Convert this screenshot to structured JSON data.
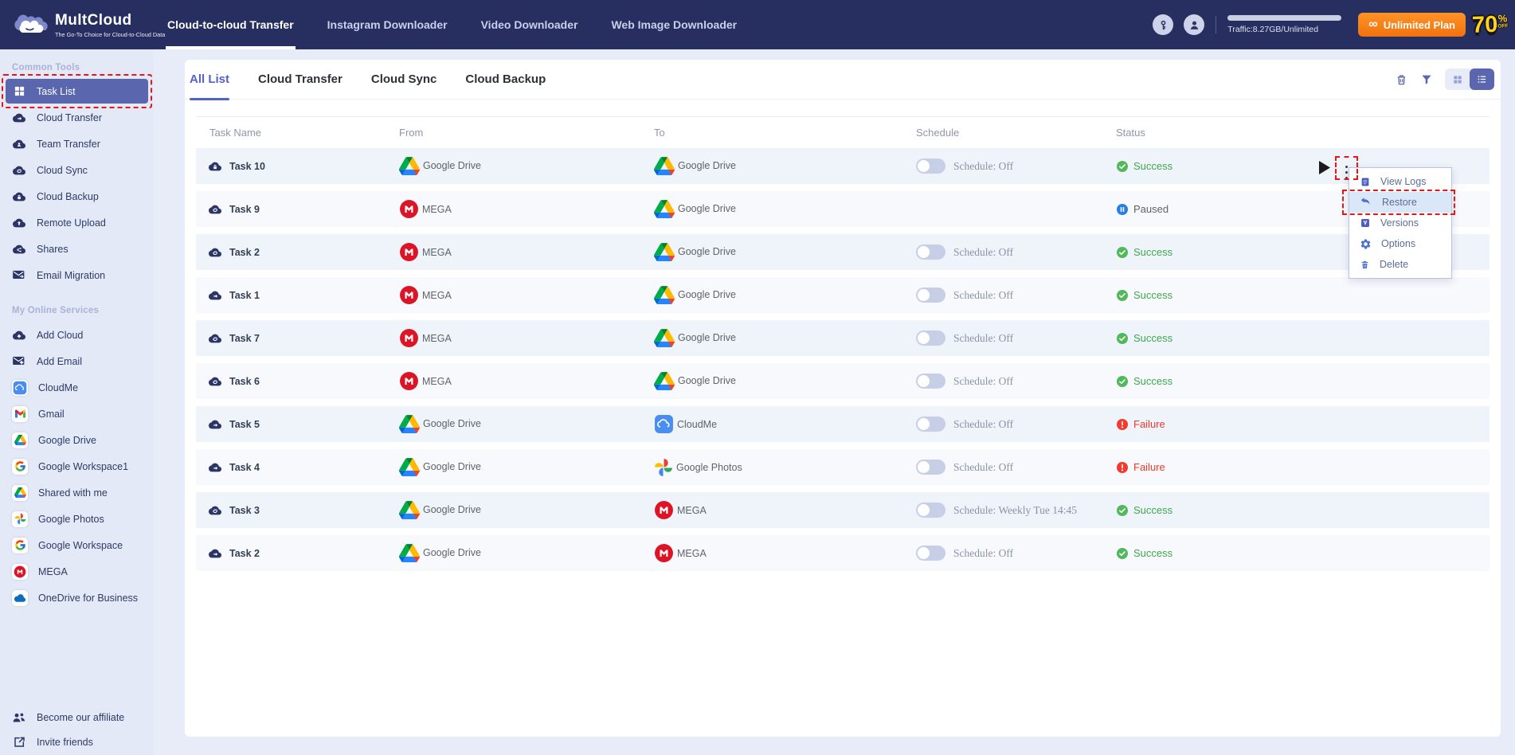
{
  "nav": {
    "brand": "MultCloud",
    "tagline": "The Go-To Choice for Cloud-to-Cloud Data",
    "items": [
      {
        "label": "Cloud-to-cloud Transfer",
        "active": true
      },
      {
        "label": "Instagram Downloader",
        "active": false
      },
      {
        "label": "Video Downloader",
        "active": false
      },
      {
        "label": "Web Image Downloader",
        "active": false
      }
    ],
    "traffic_label": "Traffic:8.27GB/Unlimited",
    "plan_button": "Unlimited Plan",
    "plan_infinity": "∞",
    "discount_badge": {
      "value": "70",
      "percent": "%",
      "off": "OFF"
    }
  },
  "sidebar": {
    "sections": [
      {
        "title": "Common Tools",
        "items": [
          {
            "label": "Task List",
            "icon": "task-list",
            "active": true,
            "annotated": true
          },
          {
            "label": "Cloud Transfer",
            "icon": "cloud-transfer"
          },
          {
            "label": "Team Transfer",
            "icon": "team-transfer"
          },
          {
            "label": "Cloud Sync",
            "icon": "cloud-sync"
          },
          {
            "label": "Cloud Backup",
            "icon": "cloud-backup"
          },
          {
            "label": "Remote Upload",
            "icon": "remote-upload"
          },
          {
            "label": "Shares",
            "icon": "shares"
          },
          {
            "label": "Email Migration",
            "icon": "email-migration"
          }
        ]
      },
      {
        "title": "My Online Services",
        "items": [
          {
            "label": "Add Cloud",
            "icon": "add-cloud"
          },
          {
            "label": "Add Email",
            "icon": "add-email"
          },
          {
            "label": "CloudMe",
            "icon": "cloudme",
            "chip": true
          },
          {
            "label": "Gmail",
            "icon": "gmail",
            "chip": true
          },
          {
            "label": "Google Drive",
            "icon": "google-drive",
            "chip": true
          },
          {
            "label": "Google Workspace1",
            "icon": "google-g",
            "chip": true
          },
          {
            "label": "Shared with me",
            "icon": "google-drive",
            "chip": true
          },
          {
            "label": "Google Photos",
            "icon": "google-photos",
            "chip": true
          },
          {
            "label": "Google Workspace",
            "icon": "google-g",
            "chip": true
          },
          {
            "label": "MEGA",
            "icon": "mega",
            "chip": true
          },
          {
            "label": "OneDrive for Business",
            "icon": "onedrive",
            "chip": true
          }
        ]
      }
    ],
    "footer_items": [
      {
        "label": "Become our affiliate",
        "icon": "affiliate"
      },
      {
        "label": "Invite friends",
        "icon": "invite"
      }
    ]
  },
  "main": {
    "tabs": [
      {
        "label": "All List",
        "active": true
      },
      {
        "label": "Cloud Transfer",
        "active": false
      },
      {
        "label": "Cloud Sync",
        "active": false
      },
      {
        "label": "Cloud Backup",
        "active": false
      }
    ],
    "toolbar_icons": [
      "trash",
      "filter",
      "grid-view",
      "list-view"
    ],
    "table": {
      "columns": [
        "Task Name",
        "From",
        "To",
        "Schedule",
        "Status"
      ],
      "rows": [
        {
          "name": "Task 10",
          "task_type": "backup",
          "from": {
            "service": "google-drive",
            "label": "Google Drive"
          },
          "to": {
            "service": "google-drive",
            "label": "Google Drive"
          },
          "schedule": {
            "enabled": false,
            "label": "Schedule: Off"
          },
          "status": {
            "label": "Success",
            "type": "success"
          }
        },
        {
          "name": "Task 9",
          "task_type": "sync",
          "from": {
            "service": "mega",
            "label": "MEGA"
          },
          "to": {
            "service": "google-drive",
            "label": "Google Drive"
          },
          "schedule": null,
          "status": {
            "label": "Paused",
            "type": "paused"
          }
        },
        {
          "name": "Task 2",
          "task_type": "sync",
          "from": {
            "service": "mega",
            "label": "MEGA"
          },
          "to": {
            "service": "google-drive",
            "label": "Google Drive"
          },
          "schedule": {
            "enabled": false,
            "label": "Schedule: Off"
          },
          "status": {
            "label": "Success",
            "type": "success"
          }
        },
        {
          "name": "Task 1",
          "task_type": "transfer",
          "from": {
            "service": "mega",
            "label": "MEGA"
          },
          "to": {
            "service": "google-drive",
            "label": "Google Drive"
          },
          "schedule": {
            "enabled": false,
            "label": "Schedule: Off"
          },
          "status": {
            "label": "Success",
            "type": "success"
          }
        },
        {
          "name": "Task 7",
          "task_type": "sync",
          "from": {
            "service": "mega",
            "label": "MEGA"
          },
          "to": {
            "service": "google-drive",
            "label": "Google Drive"
          },
          "schedule": {
            "enabled": false,
            "label": "Schedule: Off"
          },
          "status": {
            "label": "Success",
            "type": "success"
          }
        },
        {
          "name": "Task 6",
          "task_type": "sync",
          "from": {
            "service": "mega",
            "label": "MEGA"
          },
          "to": {
            "service": "google-drive",
            "label": "Google Drive"
          },
          "schedule": {
            "enabled": false,
            "label": "Schedule: Off"
          },
          "status": {
            "label": "Success",
            "type": "success"
          }
        },
        {
          "name": "Task 5",
          "task_type": "transfer",
          "from": {
            "service": "google-drive",
            "label": "Google Drive"
          },
          "to": {
            "service": "cloudme",
            "label": "CloudMe"
          },
          "schedule": {
            "enabled": false,
            "label": "Schedule: Off"
          },
          "status": {
            "label": "Failure",
            "type": "failure"
          }
        },
        {
          "name": "Task 4",
          "task_type": "transfer",
          "from": {
            "service": "google-drive",
            "label": "Google Drive"
          },
          "to": {
            "service": "google-photos",
            "label": "Google Photos"
          },
          "schedule": {
            "enabled": false,
            "label": "Schedule: Off"
          },
          "status": {
            "label": "Failure",
            "type": "failure"
          }
        },
        {
          "name": "Task 3",
          "task_type": "sync",
          "from": {
            "service": "google-drive",
            "label": "Google Drive"
          },
          "to": {
            "service": "mega",
            "label": "MEGA"
          },
          "schedule": {
            "enabled": false,
            "label": "Schedule: Weekly Tue 14:45"
          },
          "status": {
            "label": "Success",
            "type": "success"
          }
        },
        {
          "name": "Task 2",
          "task_type": "transfer",
          "from": {
            "service": "google-drive",
            "label": "Google Drive"
          },
          "to": {
            "service": "mega",
            "label": "MEGA"
          },
          "schedule": {
            "enabled": false,
            "label": "Schedule: Off"
          },
          "status": {
            "label": "Success",
            "type": "success"
          }
        }
      ]
    },
    "context_menu": {
      "items": [
        {
          "label": "View Logs",
          "icon": "logs"
        },
        {
          "label": "Restore",
          "icon": "restore",
          "highlighted": true,
          "annotated": true
        },
        {
          "label": "Versions",
          "icon": "versions"
        },
        {
          "label": "Options",
          "icon": "options"
        },
        {
          "label": "Delete",
          "icon": "delete"
        }
      ]
    }
  },
  "colors": {
    "navbar": "#262f5f",
    "accent": "#5a67ae",
    "tab_active": "#5262c8",
    "success": "#3fa84c",
    "failure": "#f0392b",
    "paused_icon": "#2a7de1",
    "plan_orange": "#f0720e",
    "annotation_red": "#e81717"
  }
}
